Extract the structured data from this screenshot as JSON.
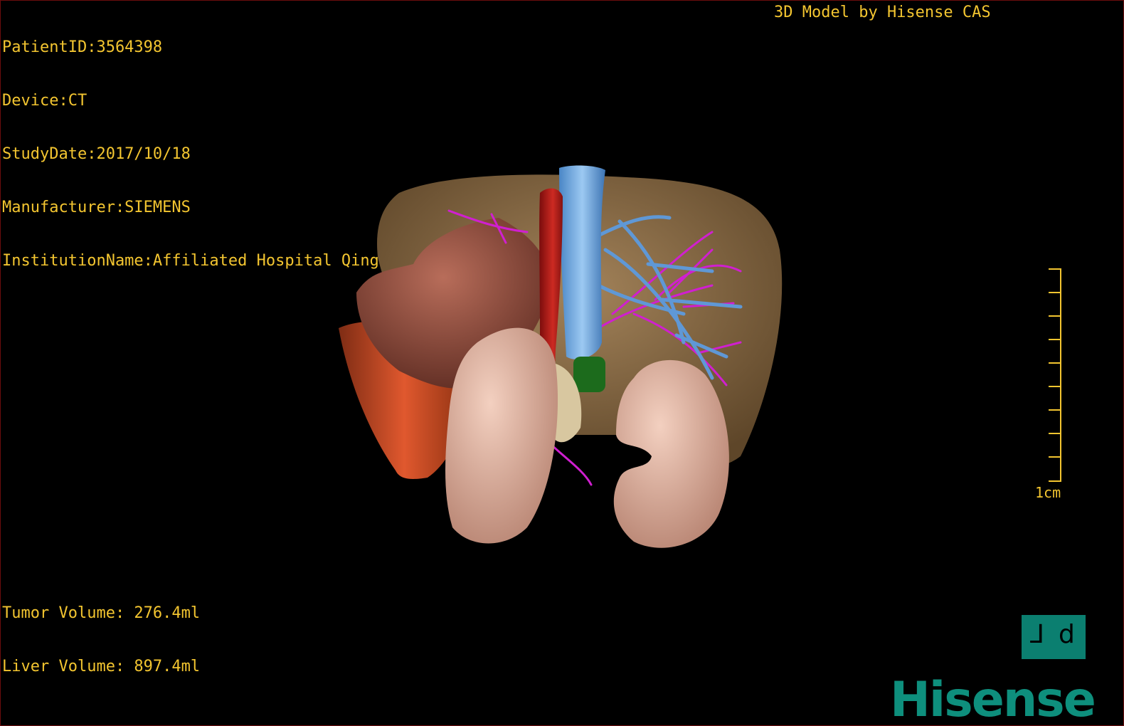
{
  "header": {
    "patient_id": "PatientID:3564398",
    "device": "Device:CT",
    "study_date": "StudyDate:2017/10/18",
    "manufacturer": "Manufacturer:SIEMENS",
    "institution": "InstitutionName:Affiliated Hospital Qingdao University-C"
  },
  "credit": "3D Model by Hisense CAS",
  "volumes": {
    "tumor": "Tumor Volume: 276.4ml",
    "liver": "Liver Volume: 897.4ml"
  },
  "scale": {
    "label": "1cm"
  },
  "orientation": {
    "left_glyph": "⅃",
    "right_glyph": "d"
  },
  "brand": {
    "logo_text": "Hisense"
  },
  "colors": {
    "overlay_text": "#f3c530",
    "liver": "#8a6b45",
    "tumor": "#8a4a3a",
    "kidney": "#e2b3a0",
    "portal_vein": "#7db0e8",
    "hepatic_artery": "#d01fd0",
    "aorta": "#b01a1a",
    "brand": "#0e8f7d"
  }
}
